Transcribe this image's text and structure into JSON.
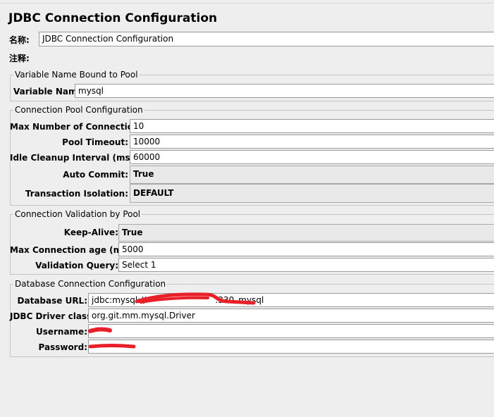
{
  "title": "JDBC Connection Configuration",
  "name_label": "名称:",
  "name_value": "JDBC Connection Configuration",
  "comment_label": "注释:",
  "comment_value": "",
  "variable_group": {
    "legend": "Variable Name Bound to Pool",
    "variable_name_label": "Variable Name:",
    "variable_name_value": "mysql"
  },
  "pool_group": {
    "legend": "Connection Pool Configuration",
    "max_connections_label": "Max Number of Connections:",
    "max_connections_value": "10",
    "pool_timeout_label": "Pool Timeout:",
    "pool_timeout_value": "10000",
    "idle_cleanup_label": "Idle Cleanup Interval (ms):",
    "idle_cleanup_value": "60000",
    "auto_commit_label": "Auto Commit:",
    "auto_commit_value": "True",
    "transaction_isolation_label": "Transaction Isolation:",
    "transaction_isolation_value": "DEFAULT"
  },
  "validation_group": {
    "legend": "Connection Validation by Pool",
    "keep_alive_label": "Keep-Alive:",
    "keep_alive_value": "True",
    "max_age_label": "Max Connection age (ms):",
    "max_age_value": "5000",
    "validation_query_label": "Validation Query:",
    "validation_query_value": "Select 1"
  },
  "database_group": {
    "legend": "Database Connection Configuration",
    "url_label": "Database URL:",
    "url_value_prefix": "jdbc:mysql://",
    "url_value_suffix": ":330",
    "url_value_db": "mysql",
    "driver_label": "JDBC Driver class:",
    "driver_value": "org.git.mm.mysql.Driver",
    "username_label": "Username:",
    "password_label": "Password:"
  },
  "colors": {
    "background": "#eeeeee",
    "field_background": "#ffffff",
    "combo_background": "#e9e9e9",
    "redaction": "#e8202a"
  }
}
